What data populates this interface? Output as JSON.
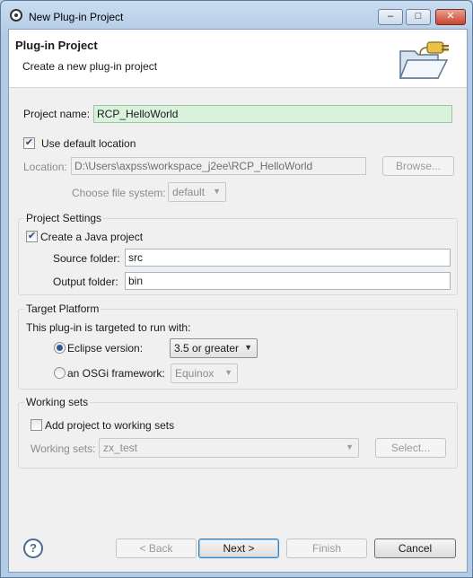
{
  "window": {
    "title": "New Plug-in Project",
    "minimize": "–",
    "maximize": "□",
    "close": "✕"
  },
  "banner": {
    "title": "Plug-in Project",
    "description": "Create a new plug-in project"
  },
  "project": {
    "name_label": "Project name:",
    "name_value": "RCP_HelloWorld",
    "use_default_label": "Use default location",
    "use_default_checked": true,
    "location_label": "Location:",
    "location_value": "D:\\Users\\axpss\\workspace_j2ee\\RCP_HelloWorld",
    "browse_label": "Browse...",
    "filesystem_label": "Choose file system:",
    "filesystem_value": "default"
  },
  "settings": {
    "group_title": "Project Settings",
    "java_label": "Create a Java project",
    "java_checked": true,
    "source_label": "Source folder:",
    "source_value": "src",
    "output_label": "Output folder:",
    "output_value": "bin"
  },
  "target": {
    "group_title": "Target Platform",
    "intro": "This plug-in is targeted to run with:",
    "eclipse_label": "Eclipse version:",
    "eclipse_value": "3.5 or greater",
    "eclipse_selected": true,
    "osgi_label": "an OSGi framework:",
    "osgi_value": "Equinox"
  },
  "working_sets": {
    "group_title": "Working sets",
    "add_label": "Add project to working sets",
    "add_checked": false,
    "sets_label": "Working sets:",
    "sets_value": "zx_test",
    "select_label": "Select..."
  },
  "footer": {
    "help": "?",
    "back": "< Back",
    "next": "Next >",
    "finish": "Finish",
    "cancel": "Cancel"
  },
  "colors": {
    "focus_field": "#d9f2dc",
    "banner_bg": "#ffffff",
    "dialog_bg": "#f0f0f0"
  }
}
